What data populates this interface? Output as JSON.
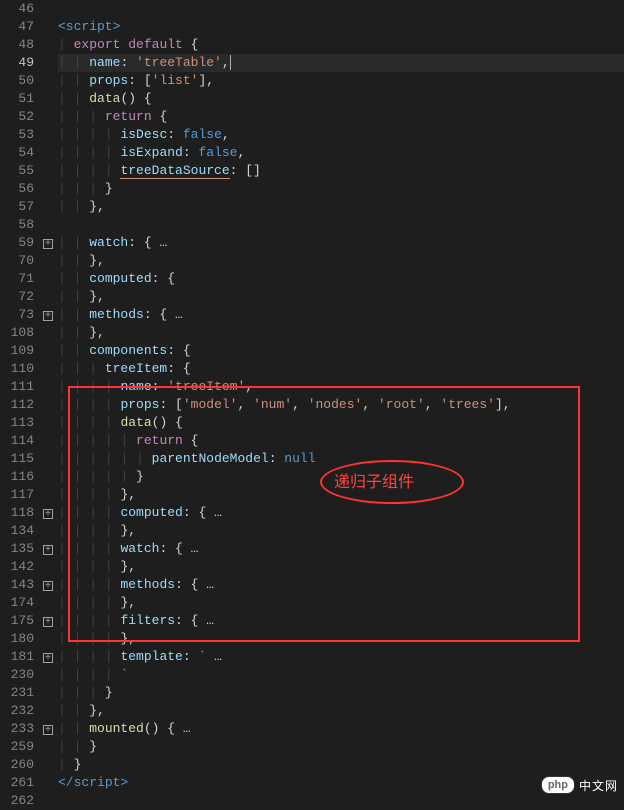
{
  "annotation": {
    "text": "递归子组件"
  },
  "watermark": {
    "badge": "php",
    "text": "中文网"
  },
  "lines": [
    {
      "n": "46",
      "fold": "",
      "indent": 0,
      "segs": []
    },
    {
      "n": "47",
      "fold": "",
      "indent": 0,
      "segs": [
        {
          "c": "tag",
          "t": "<script>"
        }
      ]
    },
    {
      "n": "48",
      "fold": "",
      "indent": 1,
      "segs": [
        {
          "c": "kw",
          "t": "export"
        },
        {
          "c": "punc",
          "t": " "
        },
        {
          "c": "kw",
          "t": "default"
        },
        {
          "c": "punc",
          "t": " {"
        }
      ]
    },
    {
      "n": "49",
      "fold": "",
      "hl": true,
      "indent": 2,
      "segs": [
        {
          "c": "prop",
          "t": "name"
        },
        {
          "c": "punc",
          "t": ": "
        },
        {
          "c": "str",
          "t": "'treeTable'"
        },
        {
          "c": "punc",
          "t": ","
        },
        {
          "c": "cursor",
          "t": ""
        }
      ]
    },
    {
      "n": "50",
      "fold": "",
      "indent": 2,
      "segs": [
        {
          "c": "prop",
          "t": "props"
        },
        {
          "c": "punc",
          "t": ": ["
        },
        {
          "c": "str",
          "t": "'list'"
        },
        {
          "c": "punc",
          "t": "],"
        }
      ]
    },
    {
      "n": "51",
      "fold": "",
      "indent": 2,
      "segs": [
        {
          "c": "fn",
          "t": "data"
        },
        {
          "c": "punc",
          "t": "() {"
        }
      ]
    },
    {
      "n": "52",
      "fold": "",
      "indent": 3,
      "segs": [
        {
          "c": "kw",
          "t": "return"
        },
        {
          "c": "punc",
          "t": " {"
        }
      ]
    },
    {
      "n": "53",
      "fold": "",
      "indent": 4,
      "segs": [
        {
          "c": "prop",
          "t": "isDesc"
        },
        {
          "c": "punc",
          "t": ": "
        },
        {
          "c": "lit",
          "t": "false"
        },
        {
          "c": "punc",
          "t": ","
        }
      ]
    },
    {
      "n": "54",
      "fold": "",
      "indent": 4,
      "segs": [
        {
          "c": "prop",
          "t": "isExpand"
        },
        {
          "c": "punc",
          "t": ": "
        },
        {
          "c": "lit",
          "t": "false"
        },
        {
          "c": "punc",
          "t": ","
        }
      ]
    },
    {
      "n": "55",
      "fold": "",
      "indent": 4,
      "segs": [
        {
          "c": "prop",
          "w": true,
          "t": "treeDataSource"
        },
        {
          "c": "punc",
          "t": ": []"
        }
      ]
    },
    {
      "n": "56",
      "fold": "",
      "indent": 3,
      "segs": [
        {
          "c": "punc",
          "t": "}"
        }
      ]
    },
    {
      "n": "57",
      "fold": "",
      "indent": 2,
      "segs": [
        {
          "c": "punc",
          "t": "},"
        }
      ]
    },
    {
      "n": "58",
      "fold": "",
      "indent": 0,
      "segs": []
    },
    {
      "n": "59",
      "fold": "+",
      "indent": 2,
      "segs": [
        {
          "c": "prop",
          "t": "watch"
        },
        {
          "c": "punc",
          "t": ": {"
        },
        {
          "c": "ellip",
          "t": " …"
        }
      ]
    },
    {
      "n": "70",
      "fold": "",
      "indent": 2,
      "segs": [
        {
          "c": "punc",
          "t": "},"
        }
      ]
    },
    {
      "n": "71",
      "fold": "",
      "indent": 2,
      "segs": [
        {
          "c": "prop",
          "t": "computed"
        },
        {
          "c": "punc",
          "t": ": {"
        }
      ]
    },
    {
      "n": "72",
      "fold": "",
      "indent": 2,
      "segs": [
        {
          "c": "punc",
          "t": "},"
        }
      ]
    },
    {
      "n": "73",
      "fold": "+",
      "indent": 2,
      "segs": [
        {
          "c": "prop",
          "t": "methods"
        },
        {
          "c": "punc",
          "t": ": {"
        },
        {
          "c": "ellip",
          "t": " …"
        }
      ]
    },
    {
      "n": "108",
      "fold": "",
      "indent": 2,
      "segs": [
        {
          "c": "punc",
          "t": "},"
        }
      ]
    },
    {
      "n": "109",
      "fold": "",
      "indent": 2,
      "segs": [
        {
          "c": "prop",
          "t": "components"
        },
        {
          "c": "punc",
          "t": ": {"
        }
      ]
    },
    {
      "n": "110",
      "fold": "",
      "indent": 3,
      "segs": [
        {
          "c": "prop",
          "t": "treeItem"
        },
        {
          "c": "punc",
          "t": ": {"
        }
      ]
    },
    {
      "n": "111",
      "fold": "",
      "indent": 4,
      "segs": [
        {
          "c": "prop",
          "t": "name"
        },
        {
          "c": "punc",
          "t": ": "
        },
        {
          "c": "str",
          "t": "'treeItem'"
        },
        {
          "c": "punc",
          "t": ","
        }
      ]
    },
    {
      "n": "112",
      "fold": "",
      "indent": 4,
      "segs": [
        {
          "c": "prop",
          "t": "props"
        },
        {
          "c": "punc",
          "t": ": ["
        },
        {
          "c": "str",
          "t": "'model'"
        },
        {
          "c": "punc",
          "t": ", "
        },
        {
          "c": "str",
          "t": "'num'"
        },
        {
          "c": "punc",
          "t": ", "
        },
        {
          "c": "str",
          "t": "'nodes'"
        },
        {
          "c": "punc",
          "t": ", "
        },
        {
          "c": "str",
          "t": "'root'"
        },
        {
          "c": "punc",
          "t": ", "
        },
        {
          "c": "str",
          "t": "'trees'"
        },
        {
          "c": "punc",
          "t": "],"
        }
      ]
    },
    {
      "n": "113",
      "fold": "",
      "indent": 4,
      "segs": [
        {
          "c": "fn",
          "t": "data"
        },
        {
          "c": "punc",
          "t": "() {"
        }
      ]
    },
    {
      "n": "114",
      "fold": "",
      "indent": 5,
      "segs": [
        {
          "c": "kw",
          "t": "return"
        },
        {
          "c": "punc",
          "t": " {"
        }
      ]
    },
    {
      "n": "115",
      "fold": "",
      "indent": 6,
      "segs": [
        {
          "c": "prop",
          "t": "parentNodeModel"
        },
        {
          "c": "punc",
          "t": ": "
        },
        {
          "c": "lit",
          "t": "null"
        }
      ]
    },
    {
      "n": "116",
      "fold": "",
      "indent": 5,
      "segs": [
        {
          "c": "punc",
          "t": "}"
        }
      ]
    },
    {
      "n": "117",
      "fold": "",
      "indent": 4,
      "segs": [
        {
          "c": "punc",
          "t": "},"
        }
      ]
    },
    {
      "n": "118",
      "fold": "+",
      "indent": 4,
      "segs": [
        {
          "c": "prop",
          "t": "computed"
        },
        {
          "c": "punc",
          "t": ": {"
        },
        {
          "c": "ellip",
          "t": " …"
        }
      ]
    },
    {
      "n": "134",
      "fold": "",
      "indent": 4,
      "segs": [
        {
          "c": "punc",
          "t": "},"
        }
      ]
    },
    {
      "n": "135",
      "fold": "+",
      "indent": 4,
      "segs": [
        {
          "c": "prop",
          "t": "watch"
        },
        {
          "c": "punc",
          "t": ": {"
        },
        {
          "c": "ellip",
          "t": " …"
        }
      ]
    },
    {
      "n": "142",
      "fold": "",
      "indent": 4,
      "segs": [
        {
          "c": "punc",
          "t": "},"
        }
      ]
    },
    {
      "n": "143",
      "fold": "+",
      "indent": 4,
      "segs": [
        {
          "c": "prop",
          "t": "methods"
        },
        {
          "c": "punc",
          "t": ": {"
        },
        {
          "c": "ellip",
          "t": " …"
        }
      ]
    },
    {
      "n": "174",
      "fold": "",
      "indent": 4,
      "segs": [
        {
          "c": "punc",
          "t": "},"
        }
      ]
    },
    {
      "n": "175",
      "fold": "+",
      "indent": 4,
      "segs": [
        {
          "c": "prop",
          "t": "filters"
        },
        {
          "c": "punc",
          "t": ": {"
        },
        {
          "c": "ellip",
          "t": " …"
        }
      ]
    },
    {
      "n": "180",
      "fold": "",
      "indent": 4,
      "segs": [
        {
          "c": "punc",
          "t": "},"
        }
      ]
    },
    {
      "n": "181",
      "fold": "+",
      "indent": 4,
      "segs": [
        {
          "c": "prop",
          "t": "template"
        },
        {
          "c": "punc",
          "t": ": "
        },
        {
          "c": "str",
          "t": "`"
        },
        {
          "c": "ellip",
          "t": " …"
        }
      ]
    },
    {
      "n": "230",
      "fold": "",
      "indent": 4,
      "segs": [
        {
          "c": "str",
          "t": "`"
        }
      ]
    },
    {
      "n": "231",
      "fold": "",
      "indent": 3,
      "segs": [
        {
          "c": "punc",
          "t": "}"
        }
      ]
    },
    {
      "n": "232",
      "fold": "",
      "indent": 2,
      "segs": [
        {
          "c": "punc",
          "t": "},"
        }
      ]
    },
    {
      "n": "233",
      "fold": "+",
      "indent": 2,
      "segs": [
        {
          "c": "fn",
          "t": "mounted"
        },
        {
          "c": "punc",
          "t": "() {"
        },
        {
          "c": "ellip",
          "t": " …"
        }
      ]
    },
    {
      "n": "259",
      "fold": "",
      "indent": 2,
      "segs": [
        {
          "c": "punc",
          "t": "}"
        }
      ]
    },
    {
      "n": "260",
      "fold": "",
      "indent": 1,
      "segs": [
        {
          "c": "punc",
          "t": "}"
        }
      ]
    },
    {
      "n": "261",
      "fold": "",
      "indent": 0,
      "segs": [
        {
          "c": "tag",
          "t": "</"
        },
        {
          "c": "tag",
          "t": "script>"
        }
      ]
    },
    {
      "n": "262",
      "fold": "",
      "indent": 0,
      "segs": []
    }
  ]
}
